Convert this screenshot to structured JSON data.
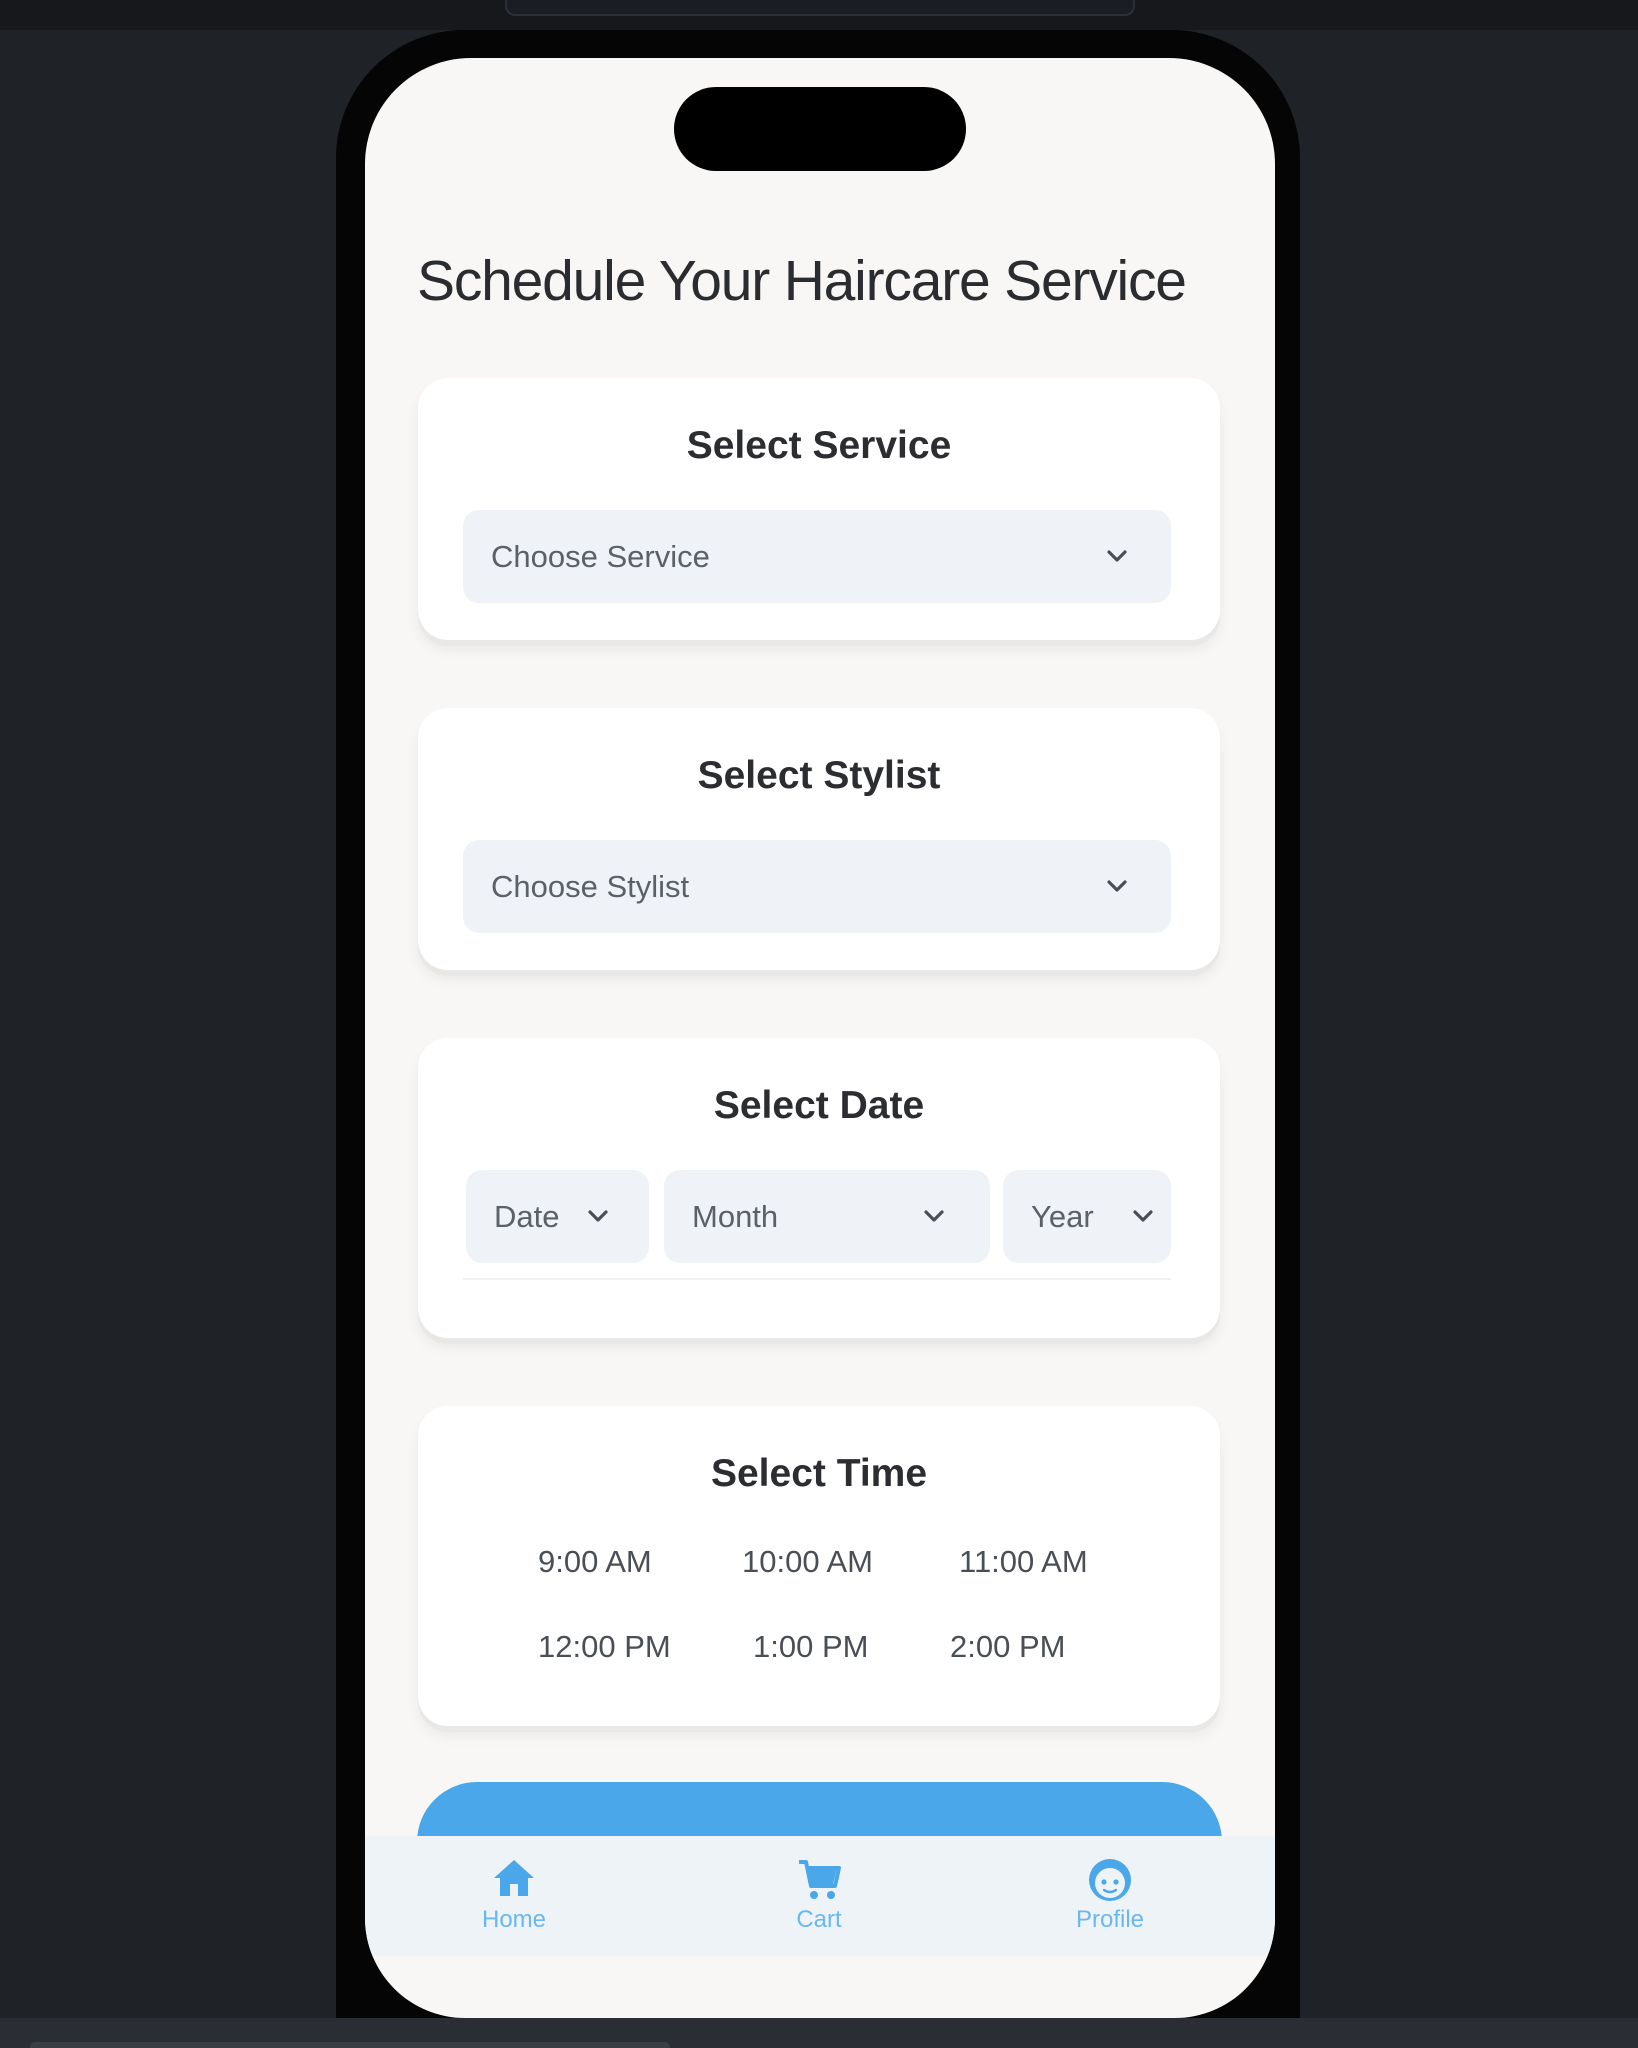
{
  "title": "Schedule Your Haircare Service",
  "service": {
    "heading": "Select Service",
    "placeholder": "Choose Service"
  },
  "stylist": {
    "heading": "Select Stylist",
    "placeholder": "Choose Stylist"
  },
  "date": {
    "heading": "Select Date",
    "date_placeholder": "Date",
    "month_placeholder": "Month",
    "year_placeholder": "Year"
  },
  "time": {
    "heading": "Select Time",
    "slots": [
      "9:00 AM",
      "10:00 AM",
      "11:00 AM",
      "12:00 PM",
      "1:00 PM",
      "2:00 PM"
    ]
  },
  "nav": {
    "items": [
      {
        "label": "Home",
        "icon": "home-icon"
      },
      {
        "label": "Cart",
        "icon": "cart-icon"
      },
      {
        "label": "Profile",
        "icon": "profile-icon"
      }
    ]
  },
  "colors": {
    "accent": "#4aa7ea",
    "background": "#1f2227",
    "screen": "#f8f7f5",
    "input": "#eff2f6"
  }
}
